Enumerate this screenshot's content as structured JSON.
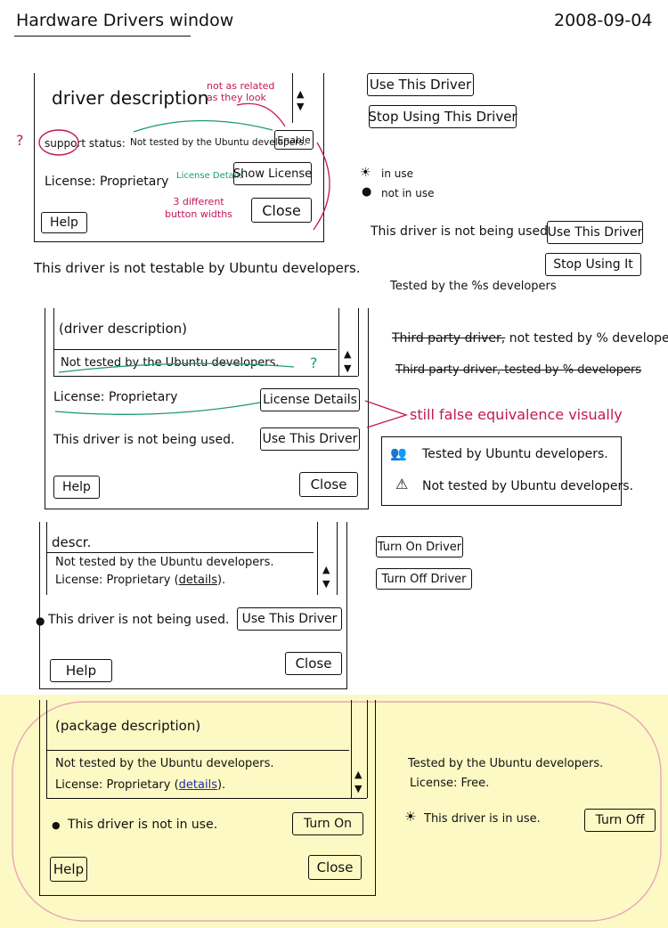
{
  "header": {
    "title": "Hardware Drivers window",
    "date": "2008-09-04"
  },
  "sketch1": {
    "heading": "driver description",
    "note_related": "not as related as they look",
    "support_status_label": "support status:",
    "support_status_value": "Not tested by the Ubuntu developers.",
    "enable_button": "Enable",
    "question_mark": "?",
    "license": "License: Proprietary",
    "license_details_note": "License Details",
    "show_license_button": "Show License",
    "note_widths": "3 different button widths",
    "help_button": "Help",
    "close_button": "Close",
    "caption": "This driver is not testable by Ubuntu developers."
  },
  "right1": {
    "use_driver_button": "Use This Driver",
    "stop_driver_button": "Stop Using This Driver",
    "legend_in_use": "in use",
    "legend_not_in_use": "not in use",
    "status_text": "This driver is not being used.",
    "use_button": "Use This Driver",
    "stop_button": "Stop Using It",
    "tested_text": "Tested by the %s developers"
  },
  "sketch2": {
    "heading": "(driver description)",
    "status_text": "Not tested by the Ubuntu developers.",
    "question_mark": "?",
    "license": "License: Proprietary",
    "license_details_button": "License Details",
    "status_not_used": "This driver is not being used.",
    "use_button": "Use This Driver",
    "help_button": "Help",
    "close_button": "Close"
  },
  "right2": {
    "alt1_struck": "Third party driver,",
    "alt1_rest": "not tested by % developers",
    "alt2_struck": "Third party driver, tested by % developers",
    "note_equivalence": "still false equivalence visually",
    "legend_tested": "Tested by Ubuntu developers.",
    "legend_not_tested": "Not tested by Ubuntu developers."
  },
  "sketch3": {
    "heading": "descr.",
    "status_text": "Not tested by the Ubuntu developers.",
    "license_prefix": "License: Proprietary (",
    "details_link": "details",
    "license_suffix": ").",
    "status_not_used": "This driver is not being used.",
    "use_button": "Use This Driver",
    "help_button": "Help",
    "close_button": "Close",
    "turn_on_button": "Turn On Driver",
    "turn_off_button": "Turn Off Driver"
  },
  "sketch4": {
    "heading": "(package description)",
    "status_text": "Not tested by the Ubuntu developers.",
    "license_prefix": "License: Proprietary (",
    "details_link": "details",
    "license_suffix": ").",
    "status_not_in_use": "This driver is not in use.",
    "turn_on_button": "Turn On",
    "help_button": "Help",
    "close_button": "Close",
    "alt_tested": "Tested by the Ubuntu developers.",
    "alt_license": "License: Free.",
    "alt_status": "This driver is in use.",
    "turn_off_button": "Turn Off"
  },
  "colors": {
    "ink": "#111111",
    "pink": "#c2185b",
    "green": "#1a9a6a",
    "highlight": "#fdf9c4",
    "link": "#1a2fb0"
  }
}
